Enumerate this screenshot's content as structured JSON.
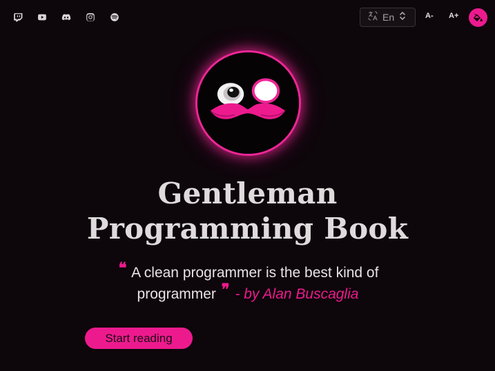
{
  "header": {
    "social_links": [
      {
        "name": "twitch-icon"
      },
      {
        "name": "youtube-icon"
      },
      {
        "name": "discord-icon"
      },
      {
        "name": "instagram-icon"
      },
      {
        "name": "spotify-icon"
      }
    ],
    "language": {
      "icon": "translate-icon",
      "value": "En"
    },
    "font_decrease_label": "A-",
    "font_increase_label": "A+",
    "theme_icon": "paint-bucket-icon"
  },
  "hero": {
    "logo_icon": "gentleman-mustache-logo",
    "title_line1": "Gentleman",
    "title_line2": "Programming Book",
    "quote_open": "❝",
    "quote_text": "A clean programmer is the best kind of programmer",
    "quote_close": "❞",
    "quote_author": "- by Alan Buscaglia",
    "cta_label": "Start reading"
  },
  "colors": {
    "background": "#0d060b",
    "accent": "#ed1a8e",
    "text": "#e6e2e4"
  }
}
